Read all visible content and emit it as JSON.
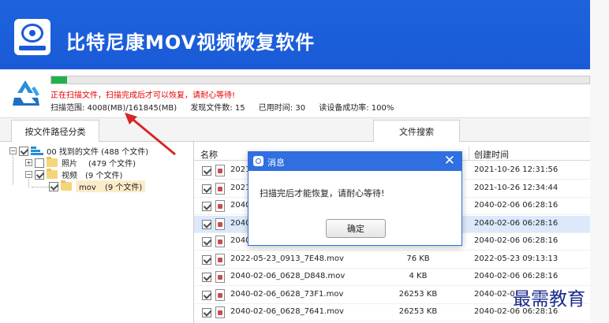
{
  "header": {
    "title": "比特尼康MOV视频恢复软件"
  },
  "scan": {
    "progress_fraction": 0.03,
    "message": "正在扫描文件，扫描完成后才可以恢复，请耐心等待!",
    "range": "扫描范围: 4008(MB)/161845(MB)",
    "found": "发现文件数: 15",
    "elapsed": "已用时间: 30",
    "read_rate": "读设备成功率: 100%"
  },
  "tabs": {
    "path": "按文件路径分类",
    "search": "文件搜索"
  },
  "tree": {
    "root": "00 找到的文件 (488 个文件)",
    "photos": "照片",
    "photos_count": "(479 个文件)",
    "videos": "视频",
    "videos_count": "(9 个文件)",
    "mov": "mov",
    "mov_count": "(9 个文件)"
  },
  "table": {
    "headers": {
      "name": "名称",
      "created": "创建时间"
    },
    "rows": [
      {
        "name": "2021",
        "size": "",
        "date": "2021-10-26  12:31:56"
      },
      {
        "name": "2021",
        "size": "",
        "date": "2021-10-26  12:34:44"
      },
      {
        "name": "2040",
        "size": "",
        "date": "2040-02-06  06:28:16"
      },
      {
        "name": "2040",
        "size": "",
        "date": "2040-02-06  06:28:16"
      },
      {
        "name": "2040",
        "size": "",
        "date": "2040-02-06  06:28:16"
      },
      {
        "name": "2022-05-23_0913_7E48.mov",
        "size": "76 KB",
        "date": "2022-05-23  09:13:13"
      },
      {
        "name": "2040-02-06_0628_D848.mov",
        "size": "4 KB",
        "date": "2040-02-06  06:28:16"
      },
      {
        "name": "2040-02-06_0628_73F1.mov",
        "size": "26253 KB",
        "date": "2040-02-0"
      },
      {
        "name": "2040-02-06_0628_7641.mov",
        "size": "26253 KB",
        "date": "2040-02-06  06:28:16"
      }
    ]
  },
  "dialog": {
    "title": "消息",
    "message": "扫描完后才能恢复，请耐心等待!",
    "ok": "确定"
  },
  "watermark": "最需教育",
  "colors": {
    "header_blue": "#1a5ad8",
    "progress_green": "#22b14c",
    "warning_red": "#e60000",
    "annotation_red": "#d62828"
  }
}
